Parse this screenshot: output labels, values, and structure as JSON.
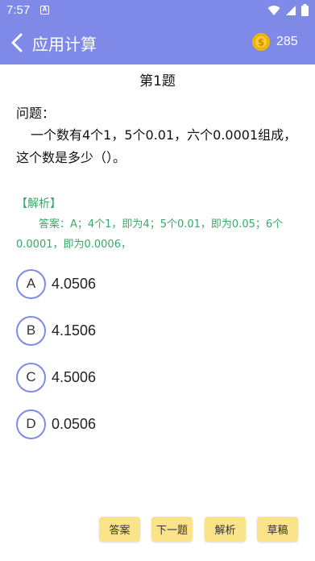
{
  "status_bar": {
    "time": "7:57",
    "notification_icon": "A"
  },
  "header": {
    "title": "应用计算",
    "coins": "285"
  },
  "question": {
    "number": "第1题",
    "label": "问题：",
    "text": "一个数有4个1，5个0.01，六个0.0001组成，这个数是多少（）。"
  },
  "analysis": {
    "label": "【解析】",
    "text": "答案：A；4个1，即为4；5个0.01，即为0.05；6个0.0001，即为0.0006，"
  },
  "options": [
    {
      "letter": "A",
      "value": "4.0506"
    },
    {
      "letter": "B",
      "value": "4.1506"
    },
    {
      "letter": "C",
      "value": "4.5006"
    },
    {
      "letter": "D",
      "value": "0.0506"
    }
  ],
  "buttons": {
    "answer": "答案",
    "next": "下一题",
    "analysis": "解析",
    "draft": "草稿"
  },
  "colors": {
    "primary": "#7f8ae8",
    "analysis_text": "#3aa86a",
    "button_bg": "#fbe38a",
    "coin": "#f5b800"
  }
}
